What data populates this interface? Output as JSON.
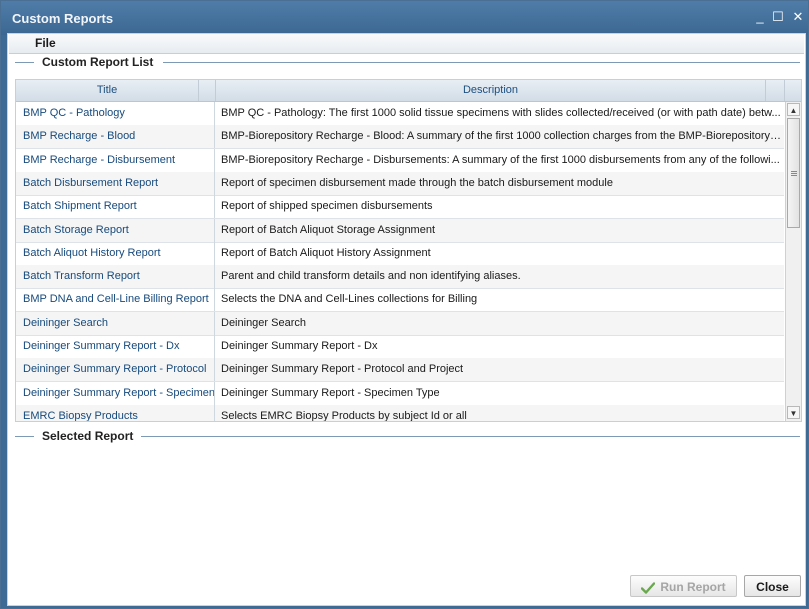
{
  "window": {
    "title": "Custom Reports",
    "minimize_glyph": "_",
    "maximize_glyph": "☐",
    "close_glyph": "✕"
  },
  "menubar": {
    "file_label": "File"
  },
  "report_list": {
    "legend": "Custom Report List",
    "columns": {
      "title": "Title",
      "description": "Description"
    },
    "rows": [
      {
        "title": "BMP QC - Pathology",
        "description": "BMP QC - Pathology: The first 1000 solid tissue specimens with slides collected/received (or with path date) betw..."
      },
      {
        "title": "BMP Recharge - Blood",
        "description": "BMP-Biorepository Recharge - Blood: A summary of the first 1000 collection charges from the BMP-Biorepository ..."
      },
      {
        "title": "BMP Recharge - Disbursement",
        "description": "BMP-Biorepository Recharge - Disbursements: A summary of the first 1000 disbursements from any of the followi..."
      },
      {
        "title": "Batch Disbursement Report",
        "description": "Report of specimen disbursement made through the batch disbursement module"
      },
      {
        "title": "Batch Shipment Report",
        "description": "Report of shipped specimen disbursements"
      },
      {
        "title": "Batch Storage Report",
        "description": "Report of Batch Aliquot Storage Assignment"
      },
      {
        "title": "Batch Aliquot History Report",
        "description": "Report of Batch Aliquot History Assignment"
      },
      {
        "title": "Batch Transform Report",
        "description": "Parent and child transform details and non identifying aliases."
      },
      {
        "title": "BMP DNA and Cell-Line Billing Report",
        "description": "Selects the DNA and Cell-Lines collections for Billing"
      },
      {
        "title": "Deininger Search",
        "description": "Deininger Search"
      },
      {
        "title": "Deininger Summary Report - Dx",
        "description": "Deininger Summary Report - Dx"
      },
      {
        "title": "Deininger Summary Report - Protocol",
        "description": "Deininger Summary Report - Protocol and Project"
      },
      {
        "title": "Deininger Summary Report - Specimen Type",
        "description": "Deininger Summary Report - Specimen Type"
      },
      {
        "title": "EMRC Biopsy Products",
        "description": "Selects EMRC Biopsy Products by subject Id or all"
      }
    ],
    "scroll_up_glyph": "▲",
    "scroll_down_glyph": "▼"
  },
  "selected_report": {
    "legend": "Selected Report"
  },
  "buttons": {
    "run_report": "Run Report",
    "close": "Close"
  },
  "colors": {
    "titlebar": "#3e6a96",
    "header_text": "#1c4f80",
    "row_title_text": "#174a7c",
    "check_green": "#4ea330"
  }
}
